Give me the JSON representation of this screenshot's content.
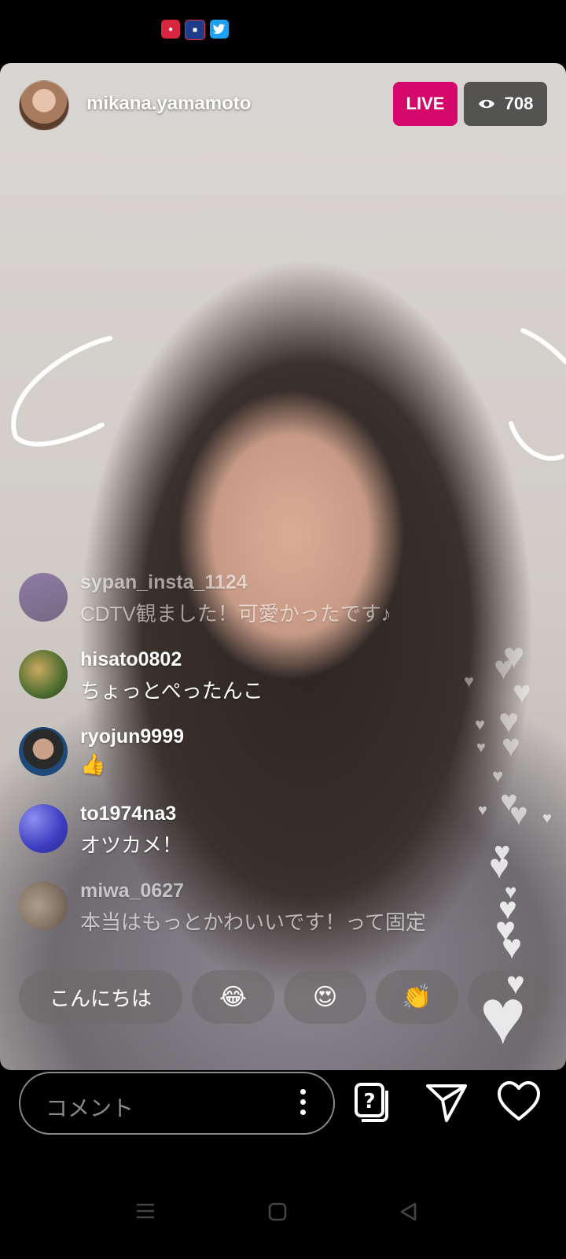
{
  "status_bar": {
    "icons": [
      "app-icon-red",
      "app-icon-bull",
      "twitter-icon"
    ]
  },
  "stream": {
    "host_name": "mikana.yamamoto",
    "live_label": "LIVE",
    "viewer_count": "708"
  },
  "comments": [
    {
      "user": "sypan_insta_1124",
      "text": "CDTV観ました！可愛かったです♪"
    },
    {
      "user": "hisato0802",
      "text": "ちょっとぺったんこ"
    },
    {
      "user": "ryojun9999",
      "text": "👍"
    },
    {
      "user": "to1974na3",
      "text": "オツカメ！"
    },
    {
      "user": "miwa_0627",
      "text": "本当はもっとかわいいです！って固定"
    }
  ],
  "quick_replies": [
    "こんにちは",
    "😂",
    "😍",
    "👏"
  ],
  "bottom_bar": {
    "comment_placeholder": "コメント"
  },
  "colors": {
    "live_badge": "#d5086b",
    "background": "#000000"
  }
}
